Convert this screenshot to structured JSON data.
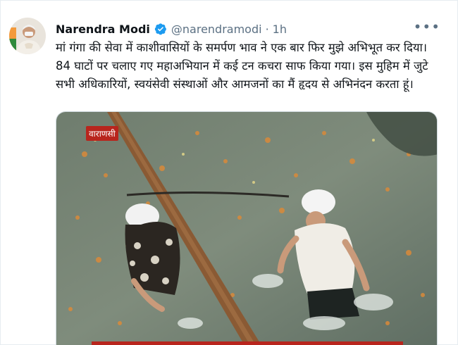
{
  "tweet": {
    "author_name": "Narendra Modi",
    "handle": "@narendramodi",
    "separator": "·",
    "time": "1h",
    "more_icon": "more-dots-icon",
    "verified_icon": "verified-badge-icon",
    "text_lines": [
      "मां गंगा की सेवा में काशीवासियों के समर्पण भाव ने एक बार फिर मुझे अभिभूत कर दिया।",
      "84 घाटों पर चलाए गए महाअभियान में कई टन कचरा साफ किया गया। इस मुहिम में जुटे",
      "सभी अधिकारियों, स्वयंसेवी संस्थाओं और आमजनों का मैं हृदय से अभिनंदन करता हूं।"
    ]
  },
  "media": {
    "location_badge": "वाराणसी"
  },
  "colors": {
    "verified": "#1d9bf0",
    "badge": "#b8251d",
    "secondary_text": "#5b7083"
  }
}
